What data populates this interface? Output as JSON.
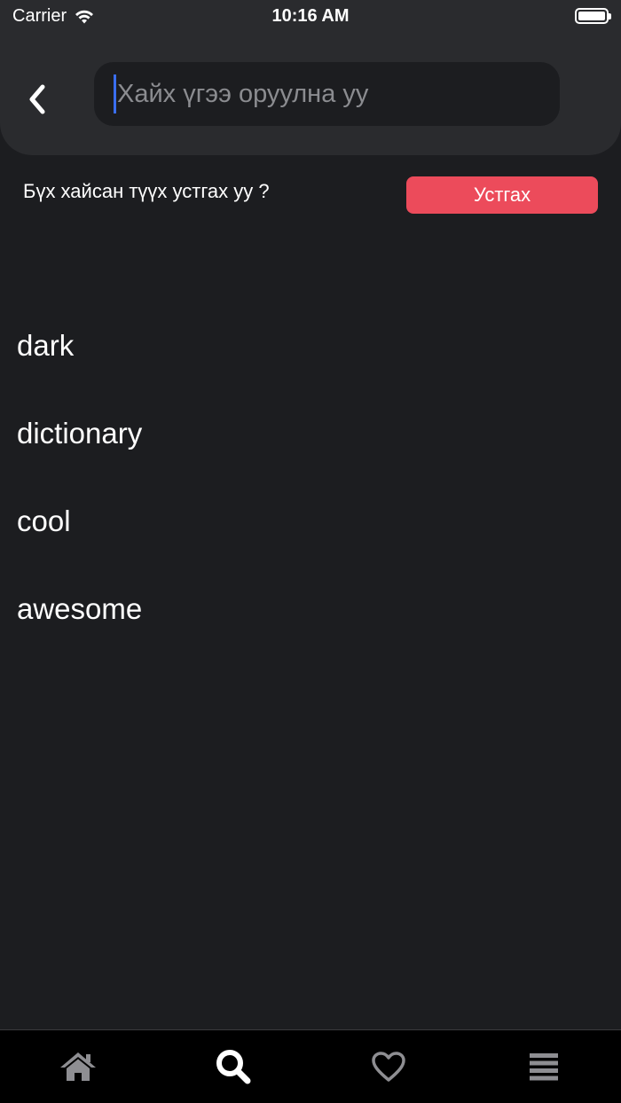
{
  "status_bar": {
    "carrier": "Carrier",
    "time": "10:16 AM"
  },
  "search": {
    "placeholder": "Хайх үгээ оруулна уу",
    "value": ""
  },
  "clear_history": {
    "prompt": "Бүх хайсан түүх устгах уу ?",
    "button_label": "Устгах"
  },
  "history": [
    {
      "word": "dark"
    },
    {
      "word": "dictionary"
    },
    {
      "word": "cool"
    },
    {
      "word": "awesome"
    }
  ],
  "tab_bar": {
    "tabs": [
      {
        "icon": "home-icon",
        "active": false
      },
      {
        "icon": "search-icon",
        "active": true
      },
      {
        "icon": "heart-icon",
        "active": false
      },
      {
        "icon": "menu-icon",
        "active": false
      }
    ]
  },
  "colors": {
    "background": "#1c1d20",
    "header": "#2a2b2e",
    "accent_delete": "#ec4b5b",
    "caret": "#3a6ef0",
    "tab_active": "#ffffff",
    "tab_inactive": "#8e8e92"
  }
}
